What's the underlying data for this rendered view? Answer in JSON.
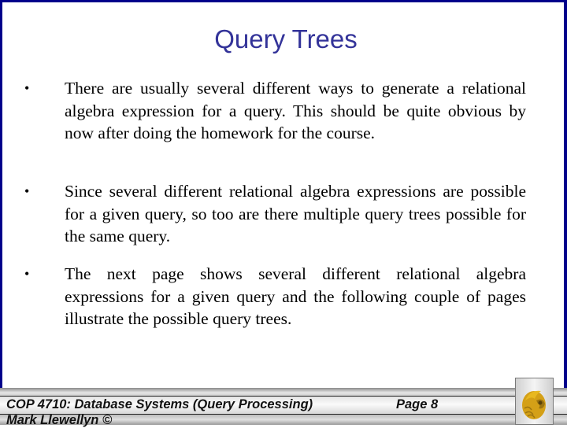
{
  "slide": {
    "title": "Query Trees",
    "bullets": [
      {
        "marker": "•",
        "text": "There are usually several different ways to generate a relational algebra expression for a query.  This should be quite obvious by now after doing the homework for the course."
      },
      {
        "marker": "•",
        "text": "Since several different relational algebra expressions are possible for a given query, so too are there multiple query trees possible for the same query."
      },
      {
        "marker": "•",
        "text": "The next page shows several different relational algebra expressions for a given query and the following couple of pages illustrate the possible query trees."
      }
    ]
  },
  "footer": {
    "course": "COP 4710: Database Systems (Query Processing)",
    "page": "Page 8",
    "author": "Mark Llewellyn ©",
    "logo_icon": "pegasus-logo-icon"
  },
  "colors": {
    "border": "#00008b",
    "title": "#333399",
    "logo_gold": "#d4a017"
  }
}
